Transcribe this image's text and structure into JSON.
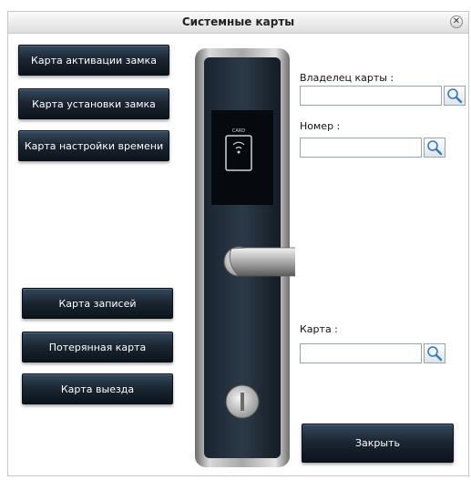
{
  "window": {
    "title": "Системные карты"
  },
  "left_buttons": [
    {
      "label": "Карта активации замка"
    },
    {
      "label": "Карта установки замка"
    },
    {
      "label": "Карта настройки времени"
    },
    {
      "label": "Карта записей"
    },
    {
      "label": "Потерянная карта"
    },
    {
      "label": "Карта выезда"
    }
  ],
  "form": {
    "owner_label": "Владелец карты :",
    "owner_value": "",
    "number_label": "Номер :",
    "number_value": "",
    "card_label": "Карта :",
    "card_value": ""
  },
  "lock_image": {
    "card_badge_text": "CARD"
  },
  "close_button": {
    "label": "Закрыть"
  },
  "icons": [
    "close-icon",
    "search-icon",
    "lock-image",
    "rfid-card-icon"
  ]
}
